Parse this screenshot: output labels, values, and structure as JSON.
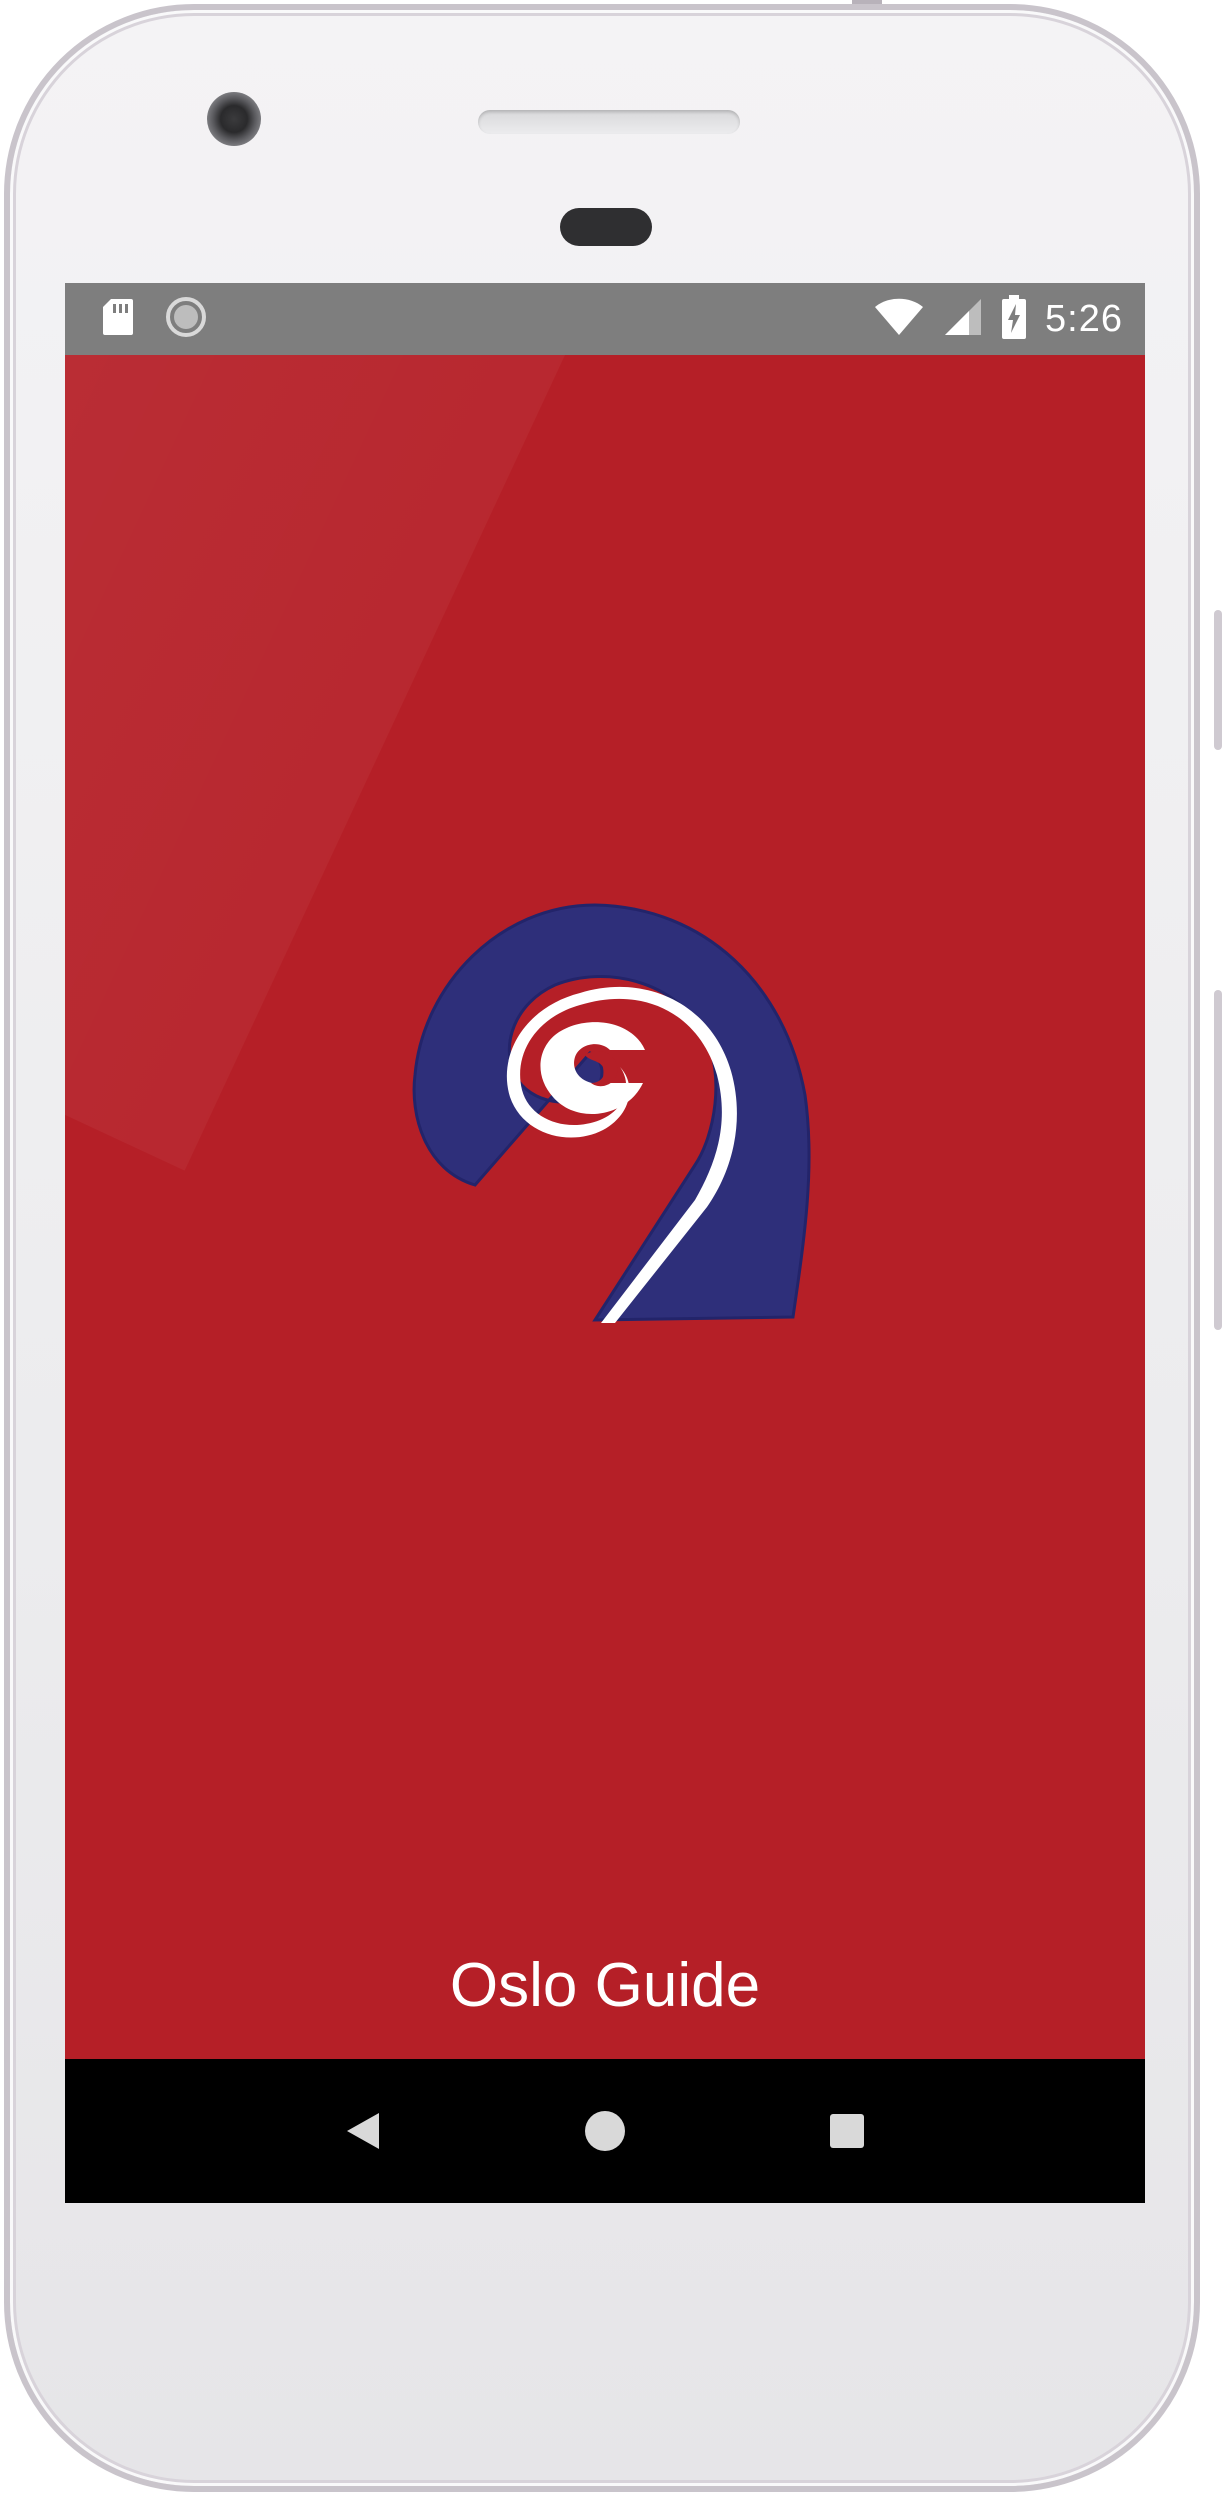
{
  "status_bar": {
    "time": "5:26",
    "left_icons": [
      "sd-card-icon",
      "sync-icon"
    ],
    "right_icons": [
      "wifi-icon",
      "cell-signal-icon",
      "battery-charging-icon"
    ]
  },
  "app": {
    "title": "Oslo Guide",
    "background_color": "#b51f27",
    "logo_colors": {
      "spiral": "#2e2f7a",
      "outline": "#ffffff",
      "center": "#b51f27"
    }
  },
  "nav_bar": {
    "buttons": [
      "back-icon",
      "home-icon",
      "recents-icon"
    ]
  }
}
